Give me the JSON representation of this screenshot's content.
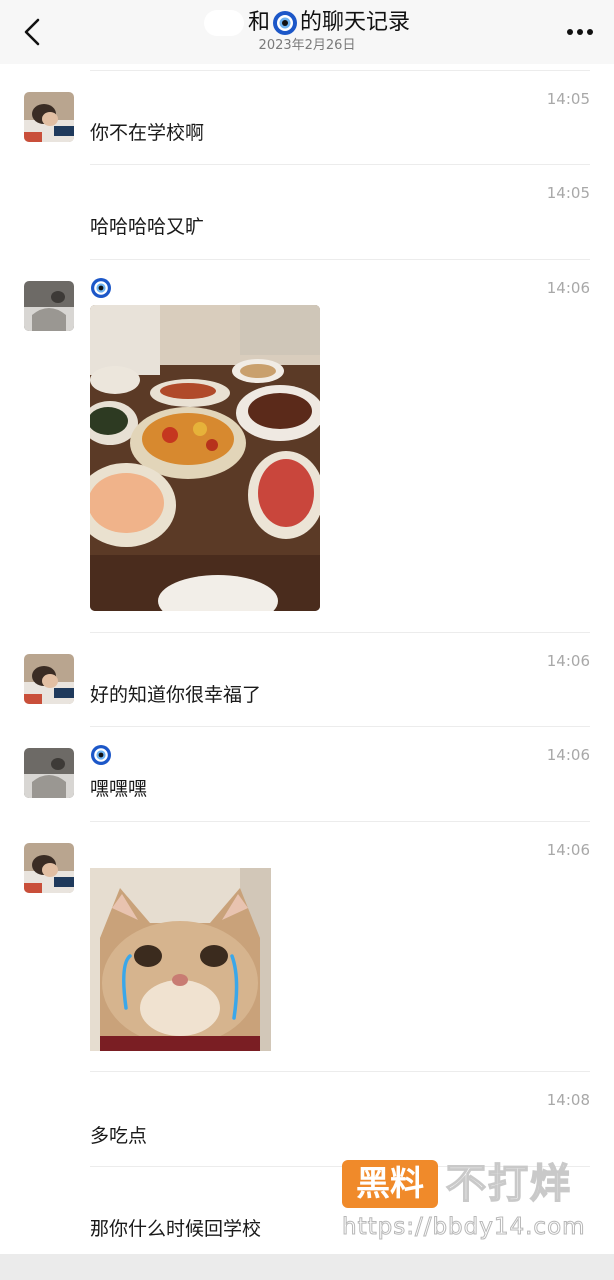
{
  "header": {
    "title_prefix": "和",
    "title_suffix": "的聊天记录",
    "date": "2023年2月26日"
  },
  "messages": [
    {
      "sender": "self",
      "time": "14:05",
      "type": "text",
      "text": "你不在学校啊"
    },
    {
      "sender": "self",
      "time": "14:05",
      "type": "text",
      "text": "哈哈哈哈又旷"
    },
    {
      "sender": "other",
      "time": "14:06",
      "type": "image",
      "image": "food-table-photo"
    },
    {
      "sender": "self",
      "time": "14:06",
      "type": "text",
      "text": "好的知道你很幸福了"
    },
    {
      "sender": "other",
      "time": "14:06",
      "type": "text",
      "text": "嘿嘿嘿"
    },
    {
      "sender": "self",
      "time": "14:06",
      "type": "sticker",
      "image": "crying-cat-sticker"
    },
    {
      "sender": "self",
      "time": "14:08",
      "type": "text",
      "text": "多吃点"
    },
    {
      "sender": "self",
      "time": "",
      "type": "text",
      "text": "那你什么时候回学校"
    }
  ],
  "watermark": {
    "logo": "黑料",
    "name": "不打烊",
    "url": "https://bbdy14.com"
  },
  "icons": {
    "back": "chevron-left-icon",
    "more": "more-dots-icon",
    "badge": "evil-eye-icon"
  },
  "colors": {
    "badge_blue": "#1c57c8",
    "watermark_orange": "#f08a2a",
    "time_gray": "#a8a8a8"
  }
}
